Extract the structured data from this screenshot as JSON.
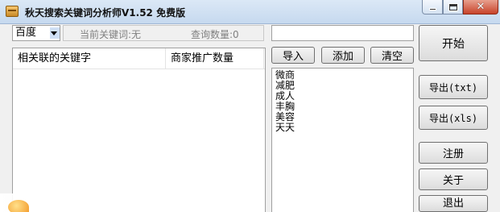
{
  "window": {
    "title": "秋天搜索关键词分析师V1.52 免费版"
  },
  "engine_select": {
    "selected": "百度"
  },
  "status": {
    "current_keyword": "当前关键词:无",
    "query_count": "查询数量:0"
  },
  "search": {
    "value": "",
    "placeholder": ""
  },
  "results_table": {
    "columns": [
      "相关联的关键字",
      "商家推广数量"
    ],
    "rows": []
  },
  "keyword_buttons": {
    "import": "导入",
    "add": "添加",
    "clear": "清空"
  },
  "keywords": [
    "微商",
    "减肥",
    "成人",
    "丰胸",
    "美容",
    "天天"
  ],
  "actions": {
    "start": "开始",
    "export_txt": "导出(txt)",
    "export_xls": "导出(xls)",
    "register": "注册",
    "about": "关于",
    "exit": "退出"
  },
  "icons": {
    "app": "app-icon",
    "minimize": "minimize-icon",
    "maximize": "maximize-icon",
    "close": "close-icon",
    "dropdown": "chevron-down-icon"
  }
}
